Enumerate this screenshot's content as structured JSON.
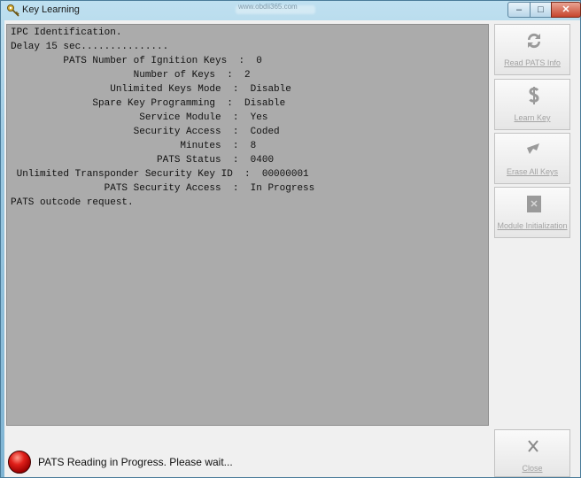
{
  "window": {
    "title": "Key Learning",
    "blurred_url": "www.obdii365.com",
    "controls": {
      "minimize": "–",
      "maximize": "□",
      "close": "✕"
    }
  },
  "console": {
    "lines": [
      "IPC Identification.",
      "Delay 15 sec...............",
      "         PATS Number of Ignition Keys  :  0",
      "                     Number of Keys  :  2",
      "                 Unlimited Keys Mode  :  Disable",
      "              Spare Key Programming  :  Disable",
      "                      Service Module  :  Yes",
      "                     Security Access  :  Coded",
      "                             Minutes  :  8",
      "                         PATS Status  :  0400",
      " Unlimited Transponder Security Key ID  :  00000001",
      "                PATS Security Access  :  In Progress",
      "PATS outcode request."
    ]
  },
  "sidebar": {
    "buttons": [
      {
        "label": "Read PATS Info",
        "icon": "refresh-arrows-icon"
      },
      {
        "label": "Learn Key",
        "icon": "dollar-key-icon"
      },
      {
        "label": "Erase All Keys",
        "icon": "eraser-icon"
      },
      {
        "label": "Module Initialization",
        "icon": "document-icon"
      }
    ]
  },
  "status": {
    "text": "PATS Reading in Progress. Please wait...",
    "indicator_color": "#e0201a"
  },
  "close_button": {
    "label": "Close",
    "icon": "close-x-icon"
  }
}
